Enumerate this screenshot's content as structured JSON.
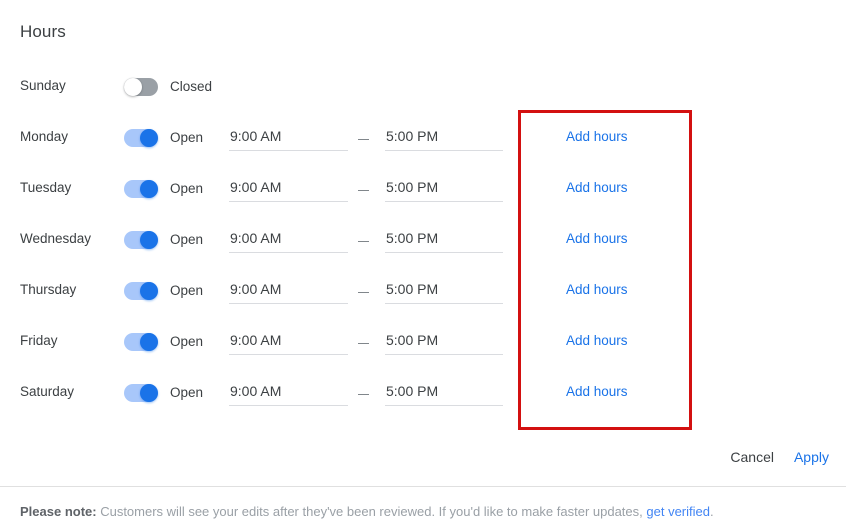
{
  "page": {
    "title": "Hours"
  },
  "columns": {
    "open_state_on": "Open",
    "open_state_off": "Closed",
    "dash": "–",
    "add_hours_label": "Add hours"
  },
  "rows": [
    {
      "day": "Sunday",
      "is_open": false,
      "state_label": "Closed",
      "open_time": "",
      "close_time": "",
      "add_hours_label": ""
    },
    {
      "day": "Monday",
      "is_open": true,
      "state_label": "Open",
      "open_time": "9:00 AM",
      "close_time": "5:00 PM",
      "add_hours_label": "Add hours"
    },
    {
      "day": "Tuesday",
      "is_open": true,
      "state_label": "Open",
      "open_time": "9:00 AM",
      "close_time": "5:00 PM",
      "add_hours_label": "Add hours"
    },
    {
      "day": "Wednesday",
      "is_open": true,
      "state_label": "Open",
      "open_time": "9:00 AM",
      "close_time": "5:00 PM",
      "add_hours_label": "Add hours"
    },
    {
      "day": "Thursday",
      "is_open": true,
      "state_label": "Open",
      "open_time": "9:00 AM",
      "close_time": "5:00 PM",
      "add_hours_label": "Add hours"
    },
    {
      "day": "Friday",
      "is_open": true,
      "state_label": "Open",
      "open_time": "9:00 AM",
      "close_time": "5:00 PM",
      "add_hours_label": "Add hours"
    },
    {
      "day": "Saturday",
      "is_open": true,
      "state_label": "Open",
      "open_time": "9:00 AM",
      "close_time": "5:00 PM",
      "add_hours_label": "Add hours"
    }
  ],
  "annotation": {
    "shape": "rectangle",
    "color": "#d31010",
    "target": "add-hours-column"
  },
  "actions": {
    "cancel_label": "Cancel",
    "apply_label": "Apply"
  },
  "footer": {
    "note_strong": "Please note:",
    "note_text": " Customers will see your edits after they've been reviewed. If you'd like to make faster updates, ",
    "note_link": "get verified",
    "note_suffix": "."
  },
  "colors": {
    "accent_blue": "#1a73e8",
    "link_blue": "#4285f4",
    "toggle_on_track": "#a8c7fa",
    "toggle_off_track": "#9aa0a6",
    "annotation_red": "#d31010",
    "text_primary": "#3c4043",
    "text_muted": "#9aa0a6"
  }
}
